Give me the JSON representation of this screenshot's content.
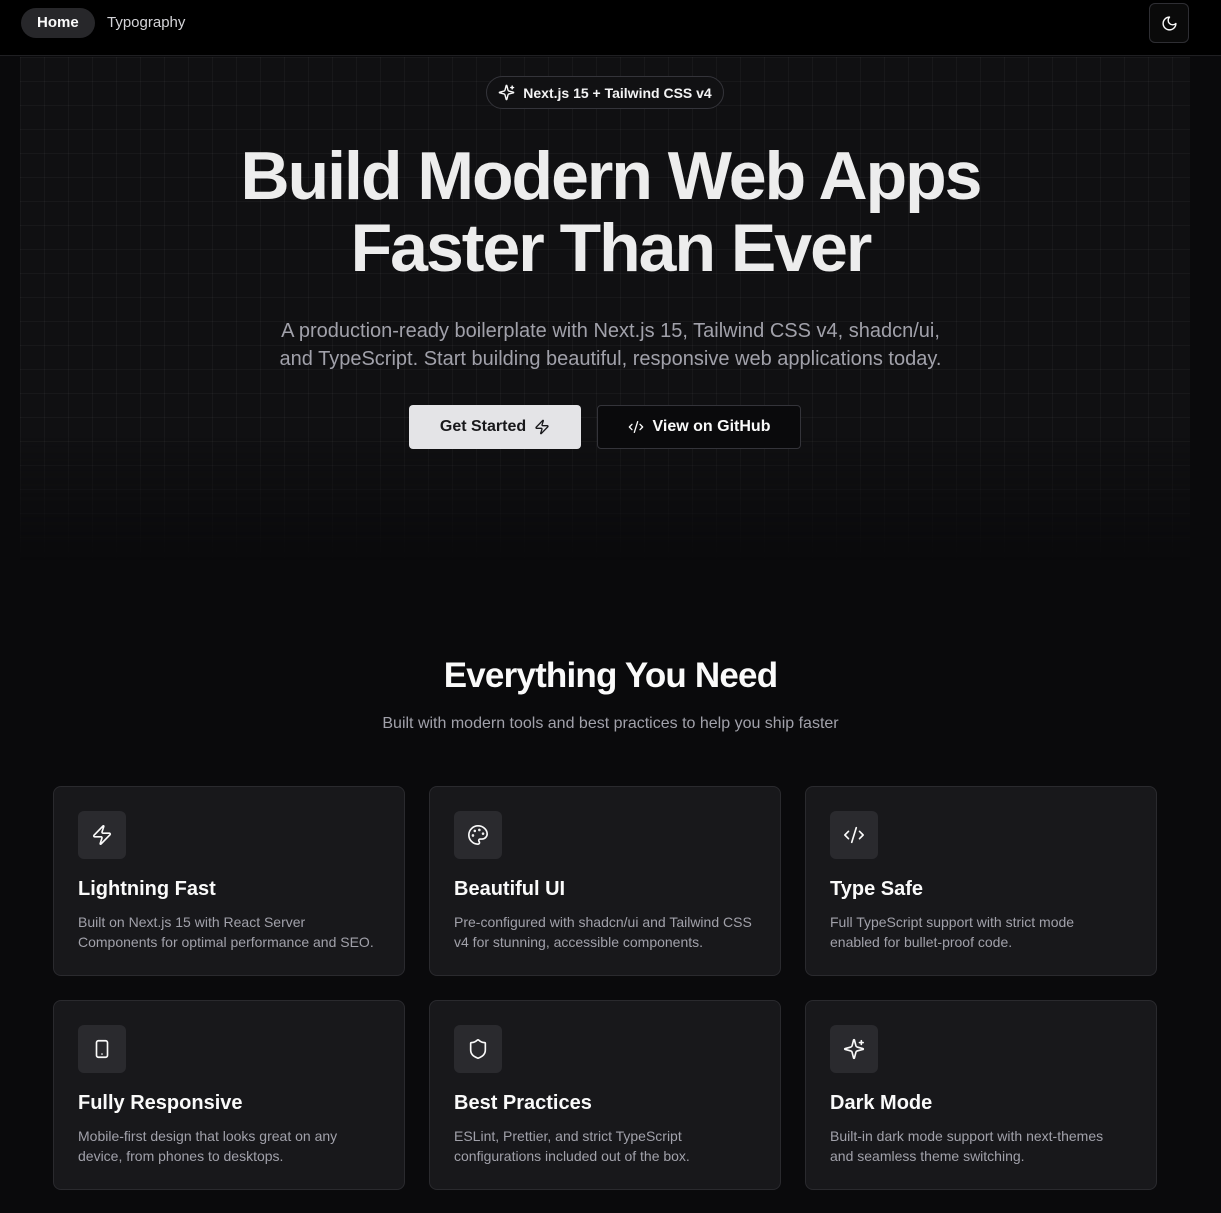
{
  "nav": {
    "items": [
      {
        "label": "Home",
        "active": true
      },
      {
        "label": "Typography",
        "active": false
      }
    ],
    "theme_toggle_icon": "moon-icon"
  },
  "hero": {
    "badge": {
      "icon": "sparkles-icon",
      "label": "Next.js 15 + Tailwind CSS v4"
    },
    "headline_line1": "Build Modern Web Apps",
    "headline_line2": "Faster Than Ever",
    "subtitle_line1": "A production-ready boilerplate with Next.js 15, Tailwind CSS v4, shadcn/ui,",
    "subtitle_line2": "and TypeScript. Start building beautiful, responsive web applications today.",
    "primary_button": {
      "label": "Get Started",
      "icon": "zap-icon"
    },
    "secondary_button": {
      "label": "View on GitHub",
      "icon": "code-icon"
    }
  },
  "features": {
    "title": "Everything You Need",
    "subtitle": "Built with modern tools and best practices to help you ship faster",
    "cards": [
      {
        "title": "Lightning Fast",
        "icon": "zap-icon",
        "desc_line1": "Built on Next.js 15 with React Server",
        "desc_line2": "Components for optimal performance and SEO."
      },
      {
        "title": "Beautiful UI",
        "icon": "palette-icon",
        "desc_line1": "Pre-configured with shadcn/ui and Tailwind CSS",
        "desc_line2": "v4 for stunning, accessible components."
      },
      {
        "title": "Type Safe",
        "icon": "code-icon",
        "desc_line1": "Full TypeScript support with strict mode",
        "desc_line2": "enabled for bullet-proof code."
      },
      {
        "title": "Fully Responsive",
        "icon": "tablet-icon",
        "desc_line1": "Mobile-first design that looks great on any",
        "desc_line2": "device, from phones to desktops."
      },
      {
        "title": "Best Practices",
        "icon": "shield-icon",
        "desc_line1": "ESLint, Prettier, and strict TypeScript",
        "desc_line2": "configurations included out of the box."
      },
      {
        "title": "Dark Mode",
        "icon": "sparkles-icon",
        "desc_line1": "Built-in dark mode support with next-themes",
        "desc_line2": "and seamless theme switching."
      }
    ]
  },
  "colors": {
    "background": "#0a0a0c",
    "card": "#18181b",
    "primary_button": "#e4e4e7",
    "muted_text": "#a1a1aa"
  }
}
